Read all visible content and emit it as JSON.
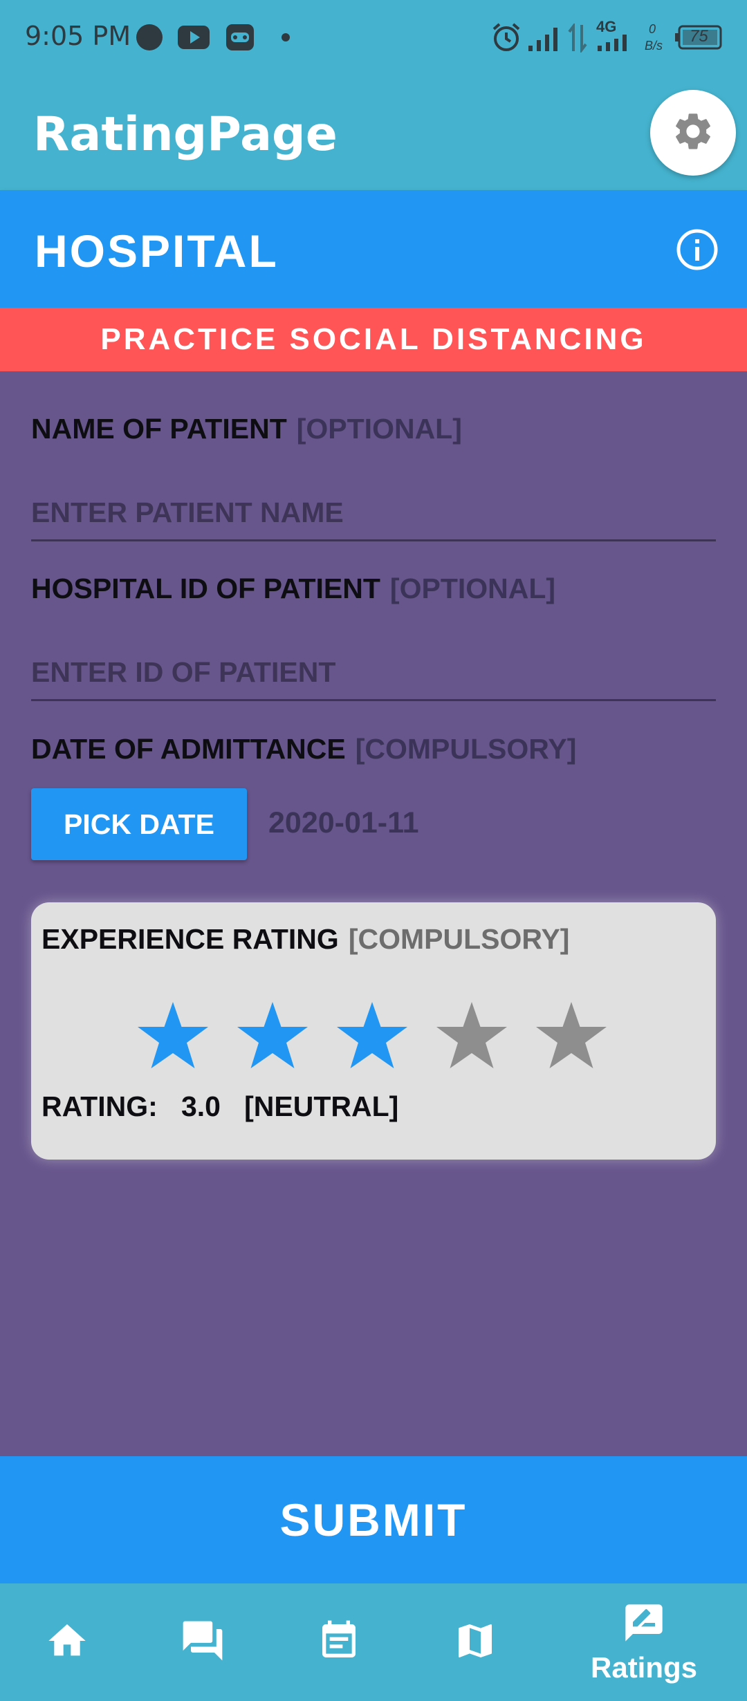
{
  "status_bar": {
    "time": "9:05 PM",
    "network": "4G",
    "speed_value": "0",
    "speed_unit": "B/s",
    "battery": "75",
    "icons": [
      "notification-dot-icon",
      "youtube-icon",
      "game-controller-icon",
      "dot-icon",
      "alarm-icon",
      "signal-icon",
      "data-arrows-icon",
      "signal-4g-icon",
      "battery-icon"
    ]
  },
  "app_bar": {
    "title": "RatingPage",
    "settings_icon": "gear-icon"
  },
  "category": {
    "title": "HOSPITAL",
    "info_icon": "info-icon"
  },
  "banner": {
    "text": "PRACTICE SOCIAL DISTANCING"
  },
  "form": {
    "patient_name": {
      "label": "NAME OF PATIENT",
      "tag": "[OPTIONAL]",
      "placeholder": "ENTER PATIENT NAME",
      "value": ""
    },
    "hospital_id": {
      "label": "HOSPITAL ID OF PATIENT",
      "tag": "[OPTIONAL]",
      "placeholder": "ENTER ID OF PATIENT",
      "value": ""
    },
    "admit_date": {
      "label": "DATE OF ADMITTANCE",
      "tag": "[COMPULSORY]",
      "button_label": "PICK DATE",
      "value": "2020-01-11"
    }
  },
  "rating": {
    "label": "EXPERIENCE RATING",
    "tag": "[COMPULSORY]",
    "readout_prefix": "RATING:",
    "value_text": "3.0",
    "sentiment": "[NEUTRAL]",
    "value": 3,
    "max": 5,
    "active_color": "#2196f3",
    "inactive_color": "#8e8e8e"
  },
  "submit": {
    "label": "SUBMIT"
  },
  "bottom_nav": {
    "items": [
      {
        "icon": "home-icon",
        "label": ""
      },
      {
        "icon": "chat-icon",
        "label": ""
      },
      {
        "icon": "calendar-note-icon",
        "label": ""
      },
      {
        "icon": "map-icon",
        "label": ""
      },
      {
        "icon": "rate-review-icon",
        "label": "Ratings"
      }
    ],
    "active_index": 4
  },
  "colors": {
    "app_bar": "#45b3cf",
    "category_bar": "#2196f3",
    "banner": "#ff5557",
    "background": "#67568c",
    "card": "#e0e0e0"
  }
}
